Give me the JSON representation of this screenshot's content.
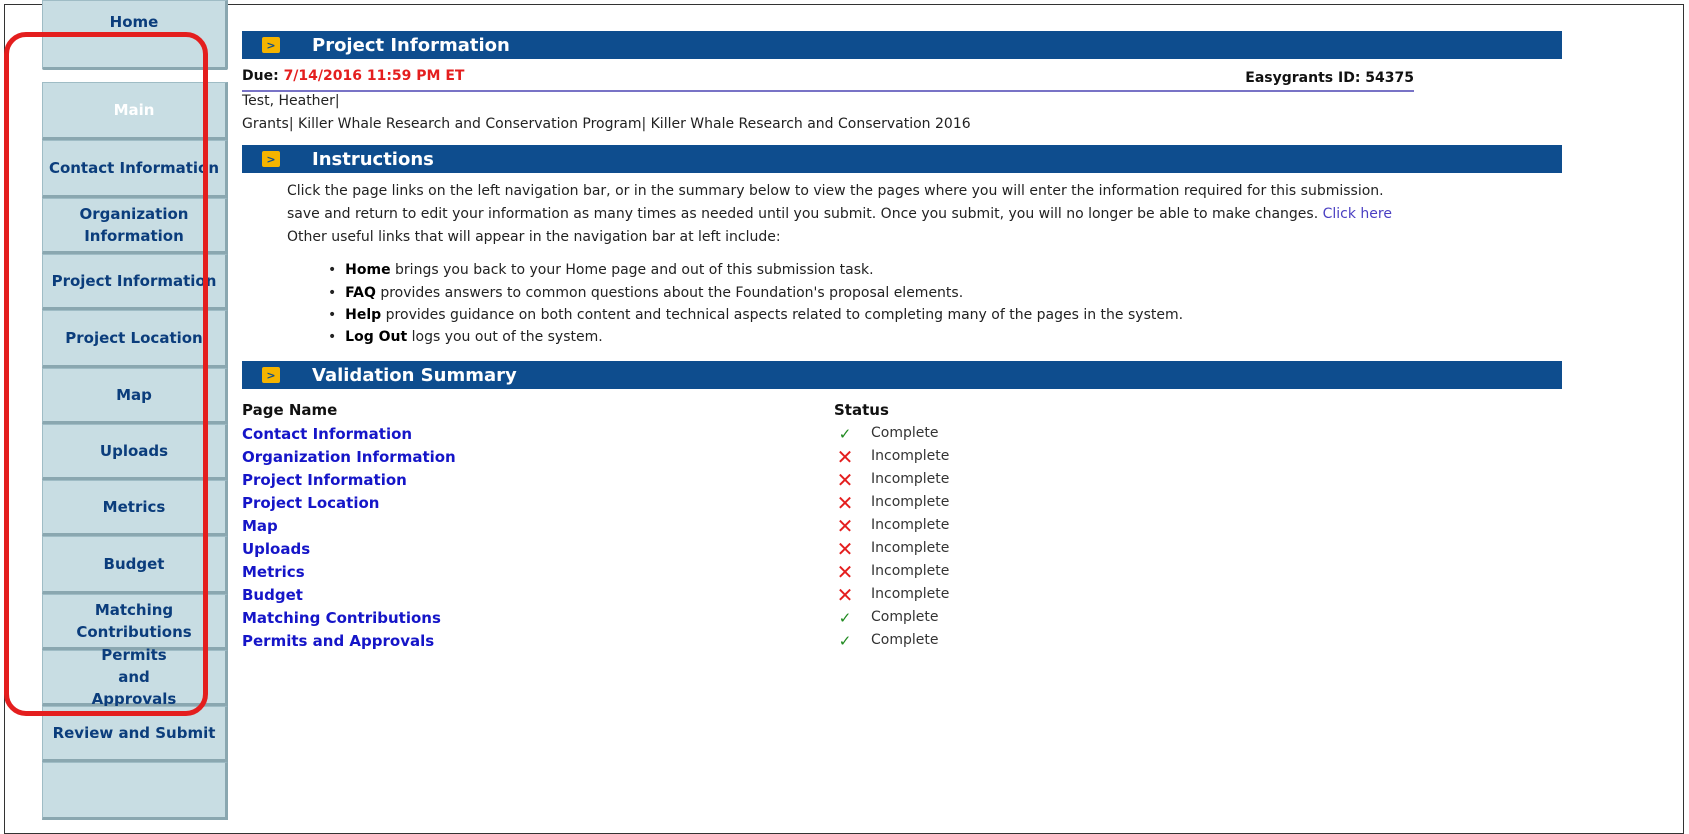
{
  "sidebar": {
    "items": [
      {
        "label": "Home"
      },
      {
        "label": "Main"
      },
      {
        "label": "Contact Information"
      },
      {
        "label": "Organization Information"
      },
      {
        "label": "Project Information"
      },
      {
        "label": "Project Location"
      },
      {
        "label": "Map"
      },
      {
        "label": "Uploads"
      },
      {
        "label": "Metrics"
      },
      {
        "label": "Budget"
      },
      {
        "label": "Matching Contributions"
      },
      {
        "label": "Permits and Approvals"
      },
      {
        "label": "Review and Submit"
      }
    ]
  },
  "project_info": {
    "header": "Project Information",
    "due_label": "Due:",
    "due_date": "7/14/2016 11:59 PM ET",
    "easygrants_id": "Easygrants ID: 54375",
    "applicant": "Test, Heather|",
    "program": "Grants| Killer Whale Research and Conservation Program| Killer Whale Research and Conservation 2016"
  },
  "instructions": {
    "header": "Instructions",
    "line1": "Click the page links on the left navigation bar, or in the summary below to view the pages where you will enter the information required for this submission.",
    "line2": "save and return to edit your information as many times as needed until you submit. Once you submit, you will no longer be able to make changes.",
    "line2_link": "Click here",
    "line3": "Other useful links that will appear in the navigation bar at left include:",
    "bullets": [
      {
        "term": "Home",
        "text": " brings you back to your Home page and out of this submission task."
      },
      {
        "term": "FAQ",
        "text": " provides answers to common questions about the Foundation's proposal elements."
      },
      {
        "term": "Help",
        "text": " provides guidance on both content and technical aspects related to completing many of the pages in the system."
      },
      {
        "term": "Log Out",
        "text": " logs you out of the system."
      }
    ]
  },
  "validation": {
    "header": "Validation Summary",
    "col_page": "Page Name",
    "col_status": "Status",
    "rows": [
      {
        "page": "Contact Information",
        "status": "Complete",
        "icon": "check-icon"
      },
      {
        "page": "Organization Information",
        "status": "Incomplete",
        "icon": "x-icon"
      },
      {
        "page": "Project Information",
        "status": "Incomplete",
        "icon": "x-icon"
      },
      {
        "page": "Project Location",
        "status": "Incomplete",
        "icon": "x-icon"
      },
      {
        "page": "Map",
        "status": "Incomplete",
        "icon": "x-icon"
      },
      {
        "page": "Uploads",
        "status": "Incomplete",
        "icon": "x-icon"
      },
      {
        "page": "Metrics",
        "status": "Incomplete",
        "icon": "x-icon"
      },
      {
        "page": "Budget",
        "status": "Incomplete",
        "icon": "x-icon"
      },
      {
        "page": "Matching Contributions",
        "status": "Complete",
        "icon": "check-icon"
      },
      {
        "page": "Permits and Approvals",
        "status": "Complete",
        "icon": "check-icon"
      }
    ]
  },
  "colors": {
    "header_bg": "#0e4d8e",
    "nav_bg": "#c8dde3",
    "highlight": "#e41e1e",
    "complete": "#1f8a1f",
    "incomplete": "#e41e1e"
  }
}
